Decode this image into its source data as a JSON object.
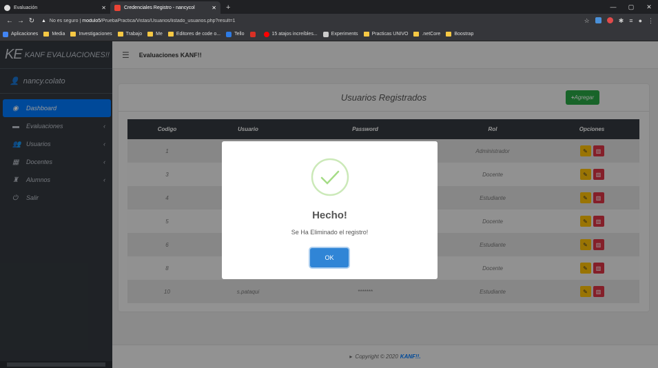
{
  "browser": {
    "tabs": [
      {
        "title": "Evaluación"
      },
      {
        "title": "Credenciales Registro - nancycol"
      }
    ],
    "address": {
      "warning": "No es seguro",
      "host": "modulo5",
      "path": "/PruebaPractica/Vistas/Usuarios/listado_usuarios.php?result=1"
    },
    "bookmarks": [
      "Aplicaciones",
      "Media",
      "Investigaciones",
      "Trabajo",
      "Me",
      "Editores de code o...",
      "Tello",
      "M",
      "15 atajos increíbles...",
      "Experiments",
      "Practicas UNIVO",
      ".netCore",
      "Boostrap"
    ]
  },
  "sidebar": {
    "logo": "KE",
    "brand": "KANF EVALUACIONES!!",
    "user": "nancy.colato",
    "items": [
      {
        "label": "Dashboard",
        "icon": "dashboard-icon"
      },
      {
        "label": "Evaluaciones",
        "icon": "folder-icon"
      },
      {
        "label": "Usuarios",
        "icon": "users-icon"
      },
      {
        "label": "Docentes",
        "icon": "building-icon"
      },
      {
        "label": "Alumnos",
        "icon": "student-icon"
      },
      {
        "label": "Salir",
        "icon": "power-icon"
      }
    ]
  },
  "topbar": {
    "title": "Evaluaciones KANF!!"
  },
  "card": {
    "title": "Usuarios Registrados",
    "add_label": "Agregar"
  },
  "table": {
    "headers": [
      "Codigo",
      "Usuario",
      "Password",
      "Rol",
      "Opciones"
    ],
    "rows": [
      {
        "codigo": "1",
        "usuario": "",
        "password": "",
        "rol": "Administrador"
      },
      {
        "codigo": "3",
        "usuario": "",
        "password": "",
        "rol": "Docente"
      },
      {
        "codigo": "4",
        "usuario": "",
        "password": "",
        "rol": "Estudiante"
      },
      {
        "codigo": "5",
        "usuario": "",
        "password": "",
        "rol": "Docente"
      },
      {
        "codigo": "6",
        "usuario": "",
        "password": "",
        "rol": "Estudiante"
      },
      {
        "codigo": "8",
        "usuario": "",
        "password": "",
        "rol": "Docente"
      },
      {
        "codigo": "10",
        "usuario": "s.pataqui",
        "password": "*******",
        "rol": "Estudiante"
      }
    ]
  },
  "footer": {
    "text": "Copyright © 2020",
    "brand": "KANF!!."
  },
  "modal": {
    "title": "Hecho!",
    "message": "Se Ha Eliminado el registro!",
    "ok_label": "OK"
  },
  "colors": {
    "primary": "#007bff",
    "success": "#28a745",
    "warning": "#ffc107",
    "danger": "#dc3545",
    "sidebar": "#343a40",
    "ok_button": "#3085d6",
    "check": "#a5dc86"
  }
}
